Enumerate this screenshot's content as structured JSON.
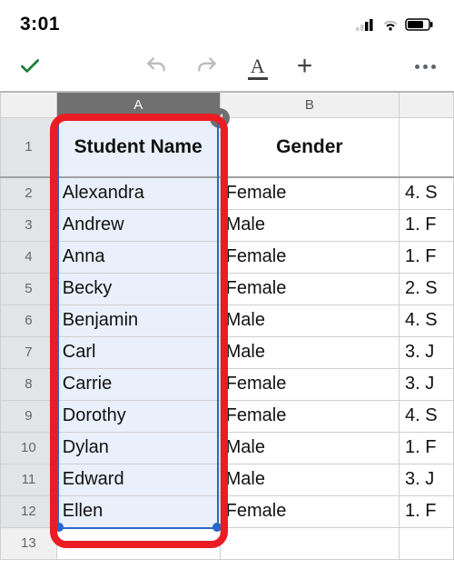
{
  "status": {
    "time": "3:01"
  },
  "toolbar": {
    "accept_label": "✓",
    "undo_label": "Undo",
    "redo_label": "Redo",
    "format_label": "A",
    "add_label": "+",
    "more_label": "More"
  },
  "columns": [
    "A",
    "B"
  ],
  "headers": {
    "A": "Student Name",
    "B": "Gender",
    "C": ""
  },
  "rows": [
    {
      "n": 2,
      "A": "Alexandra",
      "B": "Female",
      "C": "4. S"
    },
    {
      "n": 3,
      "A": "Andrew",
      "B": "Male",
      "C": "1. F"
    },
    {
      "n": 4,
      "A": "Anna",
      "B": "Female",
      "C": "1. F"
    },
    {
      "n": 5,
      "A": "Becky",
      "B": "Female",
      "C": "2. S"
    },
    {
      "n": 6,
      "A": "Benjamin",
      "B": "Male",
      "C": "4. S"
    },
    {
      "n": 7,
      "A": "Carl",
      "B": "Male",
      "C": "3. J"
    },
    {
      "n": 8,
      "A": "Carrie",
      "B": "Female",
      "C": "3. J"
    },
    {
      "n": 9,
      "A": "Dorothy",
      "B": "Female",
      "C": "4. S"
    },
    {
      "n": 10,
      "A": "Dylan",
      "B": "Male",
      "C": "1. F"
    },
    {
      "n": 11,
      "A": "Edward",
      "B": "Male",
      "C": "3. J"
    },
    {
      "n": 12,
      "A": "Ellen",
      "B": "Female",
      "C": "1. F"
    }
  ],
  "tail_rows": [
    13
  ]
}
